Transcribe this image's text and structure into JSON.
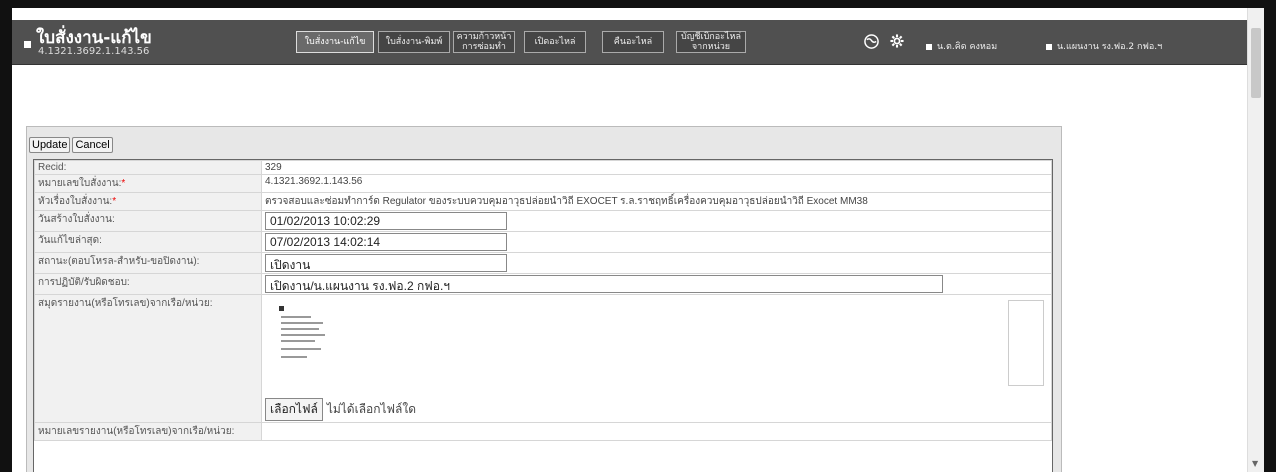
{
  "header": {
    "title": "ใบสั่งงาน-แก้ไข",
    "subtitle": "4.1321.3692.1.143.56",
    "nav": [
      {
        "label": "ใบสั่งงาน-แก้ไข"
      },
      {
        "label": "ใบสั่งงาน-พิมพ์"
      },
      {
        "line1": "ความก้าวหน้า",
        "line2": "การซ่อมทำ"
      },
      {
        "label": "เปิดอะไหล่"
      },
      {
        "label": "คืนอะไหล่"
      },
      {
        "line1": "บัญชีเบิกอะไหล่",
        "line2": "จากหน่วย"
      }
    ],
    "users": [
      "น.ต.คิด คงหอม",
      "น.แผนงาน รง.ฟอ.2 กฟอ.ฯ"
    ],
    "icons": [
      "globe-icon",
      "gear-icon"
    ]
  },
  "toolbar": {
    "update": "Update",
    "cancel": "Cancel"
  },
  "form": {
    "recid_label": "Recid:",
    "recid": "329",
    "doc_no_label": "หมายเลขใบสั่งงาน:",
    "doc_no": "4.1321.3692.1.143.56",
    "subject_label": "หัวเรื่องใบสั่งงาน:",
    "subject": "ตรวจสอบและซ่อมทำการ์ด Regulator ของระบบควบคุมอาวุธปล่อยนำวิถี EXOCET ร.ล.ราชฤทธิ์เครื่องควบคุมอาวุธปล่อยนำวิถี Exocet MM38",
    "created_label": "วันสร้างใบสั่งงาน:",
    "created": "01/02/2013 10:02:29",
    "modified_label": "วันแก้ไขล่าสุด:",
    "modified": "07/02/2013 14:02:14",
    "status_label": "สถานะ(ตอบโหรล-สำหรับ-ขอปิดงาน):",
    "status": "เปิดงาน",
    "action_label": "การปฏิบัติ/รับผิดชอบ:",
    "action": "เปิดงาน/น.แผนงาน รง.ฟอ.2 กฟอ.ฯ",
    "attach_label": "สมุดรายงาน(หรือโทรเลข)จากเรือ/หน่วย:",
    "file_button": "เลือกไฟล์",
    "file_status": "ไม่ได้เลือกไฟล์ใด",
    "ref_label": "หมายเลขรายงาน(หรือโทรเลข)จากเรือ/หน่วย:"
  }
}
